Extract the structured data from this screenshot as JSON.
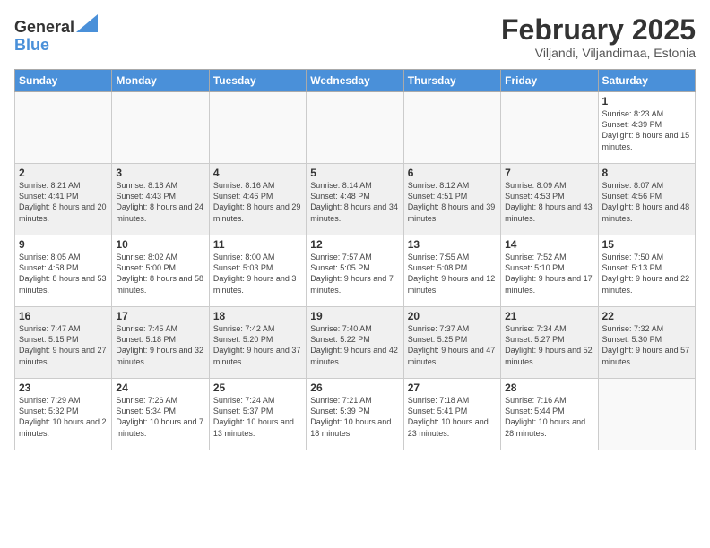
{
  "header": {
    "logo_general": "General",
    "logo_blue": "Blue",
    "month_title": "February 2025",
    "subtitle": "Viljandi, Viljandimaa, Estonia"
  },
  "weekdays": [
    "Sunday",
    "Monday",
    "Tuesday",
    "Wednesday",
    "Thursday",
    "Friday",
    "Saturday"
  ],
  "weeks": [
    [
      {
        "day": "",
        "info": ""
      },
      {
        "day": "",
        "info": ""
      },
      {
        "day": "",
        "info": ""
      },
      {
        "day": "",
        "info": ""
      },
      {
        "day": "",
        "info": ""
      },
      {
        "day": "",
        "info": ""
      },
      {
        "day": "1",
        "info": "Sunrise: 8:23 AM\nSunset: 4:39 PM\nDaylight: 8 hours and 15 minutes."
      }
    ],
    [
      {
        "day": "2",
        "info": "Sunrise: 8:21 AM\nSunset: 4:41 PM\nDaylight: 8 hours and 20 minutes."
      },
      {
        "day": "3",
        "info": "Sunrise: 8:18 AM\nSunset: 4:43 PM\nDaylight: 8 hours and 24 minutes."
      },
      {
        "day": "4",
        "info": "Sunrise: 8:16 AM\nSunset: 4:46 PM\nDaylight: 8 hours and 29 minutes."
      },
      {
        "day": "5",
        "info": "Sunrise: 8:14 AM\nSunset: 4:48 PM\nDaylight: 8 hours and 34 minutes."
      },
      {
        "day": "6",
        "info": "Sunrise: 8:12 AM\nSunset: 4:51 PM\nDaylight: 8 hours and 39 minutes."
      },
      {
        "day": "7",
        "info": "Sunrise: 8:09 AM\nSunset: 4:53 PM\nDaylight: 8 hours and 43 minutes."
      },
      {
        "day": "8",
        "info": "Sunrise: 8:07 AM\nSunset: 4:56 PM\nDaylight: 8 hours and 48 minutes."
      }
    ],
    [
      {
        "day": "9",
        "info": "Sunrise: 8:05 AM\nSunset: 4:58 PM\nDaylight: 8 hours and 53 minutes."
      },
      {
        "day": "10",
        "info": "Sunrise: 8:02 AM\nSunset: 5:00 PM\nDaylight: 8 hours and 58 minutes."
      },
      {
        "day": "11",
        "info": "Sunrise: 8:00 AM\nSunset: 5:03 PM\nDaylight: 9 hours and 3 minutes."
      },
      {
        "day": "12",
        "info": "Sunrise: 7:57 AM\nSunset: 5:05 PM\nDaylight: 9 hours and 7 minutes."
      },
      {
        "day": "13",
        "info": "Sunrise: 7:55 AM\nSunset: 5:08 PM\nDaylight: 9 hours and 12 minutes."
      },
      {
        "day": "14",
        "info": "Sunrise: 7:52 AM\nSunset: 5:10 PM\nDaylight: 9 hours and 17 minutes."
      },
      {
        "day": "15",
        "info": "Sunrise: 7:50 AM\nSunset: 5:13 PM\nDaylight: 9 hours and 22 minutes."
      }
    ],
    [
      {
        "day": "16",
        "info": "Sunrise: 7:47 AM\nSunset: 5:15 PM\nDaylight: 9 hours and 27 minutes."
      },
      {
        "day": "17",
        "info": "Sunrise: 7:45 AM\nSunset: 5:18 PM\nDaylight: 9 hours and 32 minutes."
      },
      {
        "day": "18",
        "info": "Sunrise: 7:42 AM\nSunset: 5:20 PM\nDaylight: 9 hours and 37 minutes."
      },
      {
        "day": "19",
        "info": "Sunrise: 7:40 AM\nSunset: 5:22 PM\nDaylight: 9 hours and 42 minutes."
      },
      {
        "day": "20",
        "info": "Sunrise: 7:37 AM\nSunset: 5:25 PM\nDaylight: 9 hours and 47 minutes."
      },
      {
        "day": "21",
        "info": "Sunrise: 7:34 AM\nSunset: 5:27 PM\nDaylight: 9 hours and 52 minutes."
      },
      {
        "day": "22",
        "info": "Sunrise: 7:32 AM\nSunset: 5:30 PM\nDaylight: 9 hours and 57 minutes."
      }
    ],
    [
      {
        "day": "23",
        "info": "Sunrise: 7:29 AM\nSunset: 5:32 PM\nDaylight: 10 hours and 2 minutes."
      },
      {
        "day": "24",
        "info": "Sunrise: 7:26 AM\nSunset: 5:34 PM\nDaylight: 10 hours and 7 minutes."
      },
      {
        "day": "25",
        "info": "Sunrise: 7:24 AM\nSunset: 5:37 PM\nDaylight: 10 hours and 13 minutes."
      },
      {
        "day": "26",
        "info": "Sunrise: 7:21 AM\nSunset: 5:39 PM\nDaylight: 10 hours and 18 minutes."
      },
      {
        "day": "27",
        "info": "Sunrise: 7:18 AM\nSunset: 5:41 PM\nDaylight: 10 hours and 23 minutes."
      },
      {
        "day": "28",
        "info": "Sunrise: 7:16 AM\nSunset: 5:44 PM\nDaylight: 10 hours and 28 minutes."
      },
      {
        "day": "",
        "info": ""
      }
    ]
  ]
}
